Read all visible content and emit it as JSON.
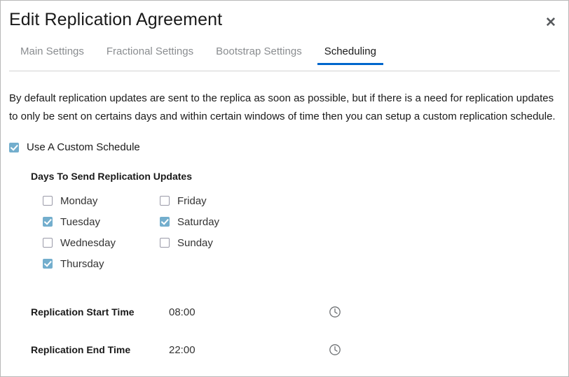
{
  "window": {
    "title": "Edit Replication Agreement",
    "close_icon": "close-icon",
    "close_label": "✕"
  },
  "tabs": [
    {
      "label": "Main Settings",
      "active": false
    },
    {
      "label": "Fractional Settings",
      "active": false
    },
    {
      "label": "Bootstrap Settings",
      "active": false
    },
    {
      "label": "Scheduling",
      "active": true
    }
  ],
  "body": {
    "intro_text": "By default replication updates are sent to the replica as soon as possible, but if there is a need for replication updates to only be sent on certains days and within certain windows of time then you can setup a custom replication schedule.",
    "custom_schedule": {
      "label": "Use A Custom Schedule",
      "checked": true
    },
    "days_section": {
      "heading": "Days To Send Replication Updates",
      "column_one": [
        {
          "label": "Monday",
          "checked": false
        },
        {
          "label": "Tuesday",
          "checked": true
        },
        {
          "label": "Wednesday",
          "checked": false
        },
        {
          "label": "Thursday",
          "checked": true
        }
      ],
      "column_two": [
        {
          "label": "Friday",
          "checked": false
        },
        {
          "label": "Saturday",
          "checked": true
        },
        {
          "label": "Sunday",
          "checked": false
        }
      ]
    },
    "times": [
      {
        "label": "Replication Start Time",
        "value": "08:00",
        "icon": "clock-icon"
      },
      {
        "label": "Replication End Time",
        "value": "22:00",
        "icon": "clock-icon"
      }
    ]
  },
  "colors": {
    "accent_blue": "#0066cc",
    "checkbox_blue": "#73aecd",
    "text_primary": "#1a1a1a",
    "text_muted": "#8a8d90",
    "border": "#d2d2d2"
  }
}
